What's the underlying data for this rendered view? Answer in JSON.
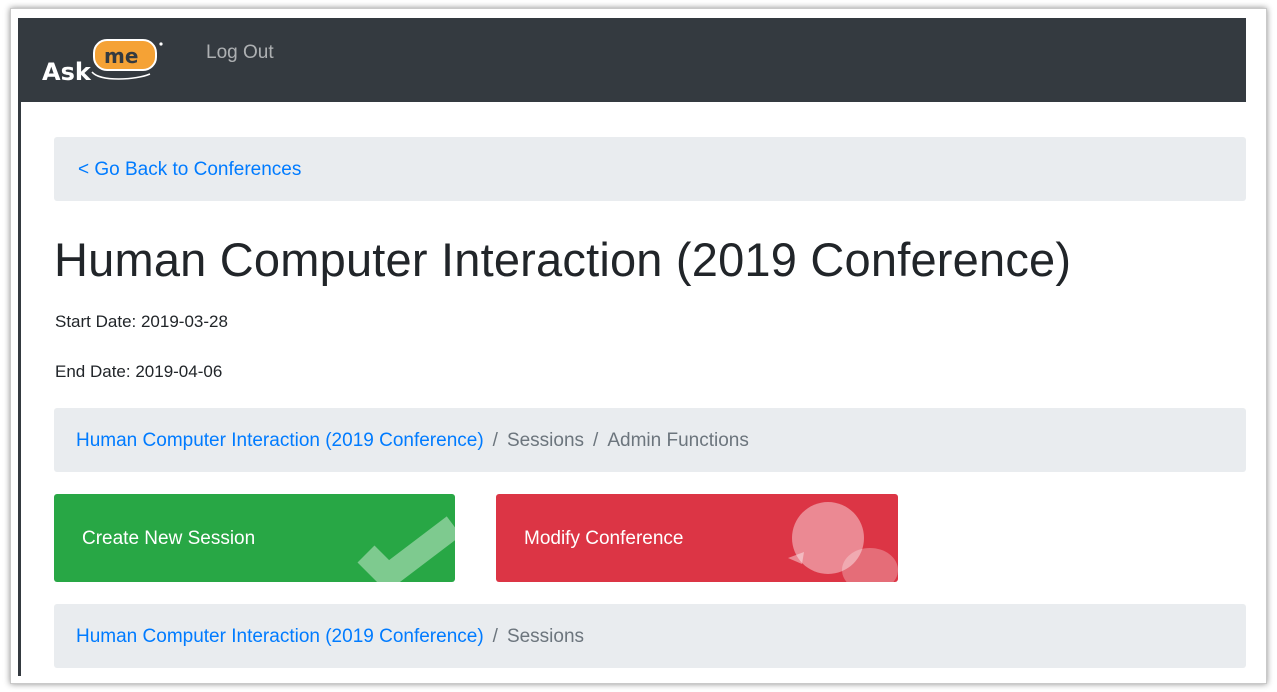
{
  "navbar": {
    "logo_text": "Ask me",
    "logout_label": "Log Out"
  },
  "back": {
    "label": "< Go Back to Conferences"
  },
  "conference": {
    "title": "Human Computer Interaction (2019 Conference)",
    "start_date": "Start Date: 2019-03-28",
    "end_date": "End Date: 2019-04-06"
  },
  "breadcrumb_admin": {
    "link": "Human Computer Interaction (2019 Conference)",
    "separator": "/",
    "items": [
      "Sessions",
      "Admin Functions"
    ]
  },
  "actions": {
    "create_label": "Create New Session",
    "create_icon": "checkmark-icon",
    "modify_label": "Modify Conference",
    "modify_icon": "speech-bubble-icon"
  },
  "breadcrumb_sessions": {
    "link": "Human Computer Interaction (2019 Conference)",
    "separator": "/",
    "items": [
      "Sessions"
    ]
  },
  "colors": {
    "navbar": "#343a40",
    "link": "#007bff",
    "success": "#28a745",
    "danger": "#dc3545",
    "breadcrumb_bg": "#e9ecef",
    "logo_orange": "#f5a235"
  }
}
